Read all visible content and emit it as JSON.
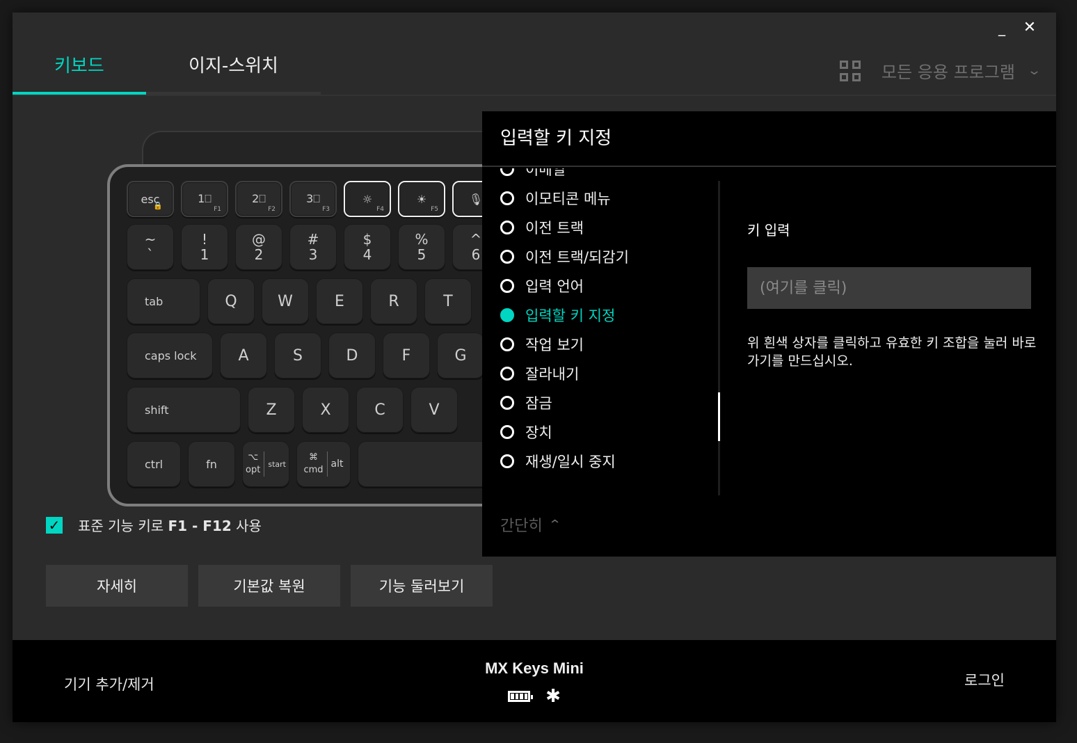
{
  "window": {
    "minimize": "_",
    "close": "✕"
  },
  "tabs": [
    {
      "label": "키보드"
    },
    {
      "label": "이지-스위치"
    }
  ],
  "apps_selector": {
    "label": "모든 응용 프로그램",
    "chevron": "⌄",
    "icon": "grid-icon"
  },
  "keyboard": {
    "frow": [
      {
        "main": "esc",
        "sub": "🔒"
      },
      {
        "main": "1⎕",
        "sub": "F1"
      },
      {
        "main": "2⎕",
        "sub": "F2"
      },
      {
        "main": "3⎕",
        "sub": "F3"
      },
      {
        "main": "☼",
        "sub": "F4"
      },
      {
        "main": "☀",
        "sub": "F5"
      },
      {
        "main": "🎙",
        "sub": ""
      }
    ],
    "nrow": [
      {
        "top": "~",
        "bot": "`"
      },
      {
        "top": "!",
        "bot": "1"
      },
      {
        "top": "@",
        "bot": "2"
      },
      {
        "top": "#",
        "bot": "3"
      },
      {
        "top": "$",
        "bot": "4"
      },
      {
        "top": "%",
        "bot": "5"
      },
      {
        "top": "^",
        "bot": "6"
      }
    ],
    "qrow": [
      "tab",
      "Q",
      "W",
      "E",
      "R",
      "T"
    ],
    "arow": [
      "caps lock",
      "A",
      "S",
      "D",
      "F",
      "G"
    ],
    "zrow": [
      "shift",
      "Z",
      "X",
      "C",
      "V"
    ],
    "brow": {
      "ctrl": "ctrl",
      "fn": "fn",
      "opt_sym": "⌥",
      "opt": "opt",
      "start": "start",
      "cmd_sym": "⌘",
      "cmd": "cmd",
      "alt": "alt"
    }
  },
  "std_fn": {
    "prefix": "표준 기능 키로 ",
    "keys": "F1 - F12",
    "suffix": " 사용",
    "checked": true
  },
  "buttons": {
    "details": "자세히",
    "restore": "기본값 복원",
    "tour": "기능 둘러보기"
  },
  "panel": {
    "title": "입력할 키 지정",
    "list": [
      {
        "label": "이메일",
        "active": false
      },
      {
        "label": "이모티콘 메뉴",
        "active": false
      },
      {
        "label": "이전 트랙",
        "active": false
      },
      {
        "label": "이전 트랙/되감기",
        "active": false
      },
      {
        "label": "입력 언어",
        "active": false
      },
      {
        "label": "입력할 키 지정",
        "active": true
      },
      {
        "label": "작업 보기",
        "active": false
      },
      {
        "label": "잘라내기",
        "active": false
      },
      {
        "label": "잠금",
        "active": false
      },
      {
        "label": "장치",
        "active": false
      },
      {
        "label": "재생/일시 중지",
        "active": false
      }
    ],
    "collapse": "간단히",
    "key_input_label": "키 입력",
    "key_input_placeholder": "(여기를 클릭)",
    "hint": "위 흰색 상자를 클릭하고 유효한 키 조합을 눌러 바로가기를 만드십시오."
  },
  "footer": {
    "add_remove": "기기 추가/제거",
    "device_name": "MX Keys Mini",
    "bluetooth": "✱",
    "login": "로그인"
  },
  "colors": {
    "accent": "#00d6c2"
  }
}
